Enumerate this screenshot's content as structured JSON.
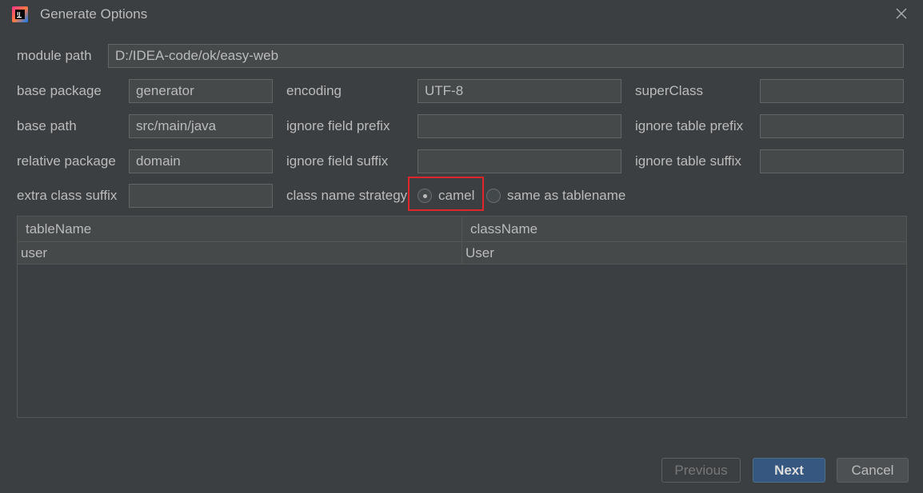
{
  "window": {
    "title": "Generate Options"
  },
  "form": {
    "module_path": {
      "label": "module path",
      "value": "D:/IDEA-code/ok/easy-web"
    },
    "base_package": {
      "label": "base package",
      "value": "generator"
    },
    "base_path": {
      "label": "base path",
      "value": "src/main/java"
    },
    "relative_package": {
      "label": "relative package",
      "value": "domain"
    },
    "extra_class_suffix": {
      "label": "extra class suffix",
      "value": ""
    },
    "encoding": {
      "label": "encoding",
      "value": "UTF-8"
    },
    "ignore_field_prefix": {
      "label": "ignore field prefix",
      "value": ""
    },
    "ignore_field_suffix": {
      "label": "ignore field suffix",
      "value": ""
    },
    "super_class": {
      "label": "superClass",
      "value": ""
    },
    "ignore_table_prefix": {
      "label": "ignore table prefix",
      "value": ""
    },
    "ignore_table_suffix": {
      "label": "ignore table suffix",
      "value": ""
    },
    "class_name_strategy": {
      "label": "class name strategy",
      "options": [
        "camel",
        "same as tablename"
      ],
      "selected": "camel"
    }
  },
  "table": {
    "columns": [
      "tableName",
      "className"
    ],
    "rows": [
      [
        "user",
        "User"
      ]
    ]
  },
  "buttons": {
    "previous": "Previous",
    "next": "Next",
    "cancel": "Cancel"
  }
}
